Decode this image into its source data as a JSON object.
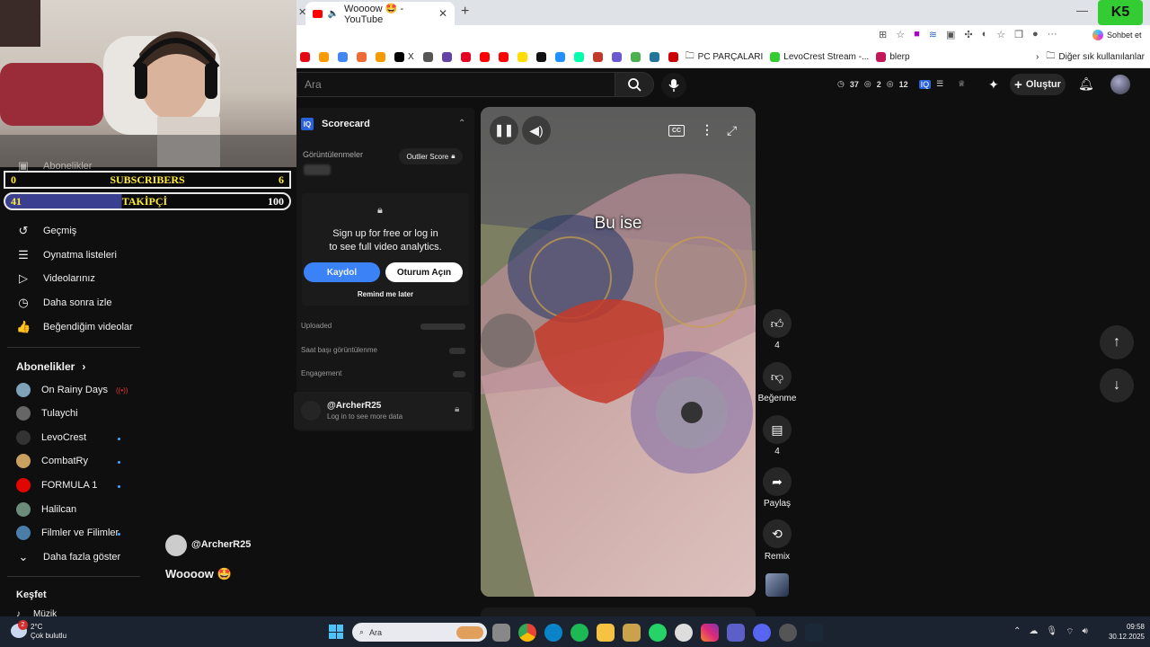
{
  "browser": {
    "tab_title": "Woooow 🤩 - YouTube",
    "bookmarks": [
      {
        "label": "",
        "color": "#e50914"
      },
      {
        "label": "",
        "color": "#ff9900"
      },
      {
        "label": "",
        "color": "#4285f4"
      },
      {
        "label": "",
        "color": "#f06a35"
      },
      {
        "label": "",
        "color": "#f59b00"
      },
      {
        "label": "X",
        "color": "#000000"
      },
      {
        "label": "",
        "color": "#555555"
      },
      {
        "label": "",
        "color": "#6441a5"
      },
      {
        "label": "",
        "color": "#e60023"
      },
      {
        "label": "",
        "color": "#ff0000"
      },
      {
        "label": "",
        "color": "#ff0000"
      },
      {
        "label": "",
        "color": "#ffdd00"
      },
      {
        "label": "",
        "color": "#111111"
      },
      {
        "label": "",
        "color": "#1e90ff"
      },
      {
        "label": "",
        "color": "#0fa"
      },
      {
        "label": "",
        "color": "#c0392b"
      },
      {
        "label": "",
        "color": "#6a5acd"
      },
      {
        "label": "",
        "color": "#4caf50"
      },
      {
        "label": "",
        "color": "#21759b"
      },
      {
        "label": "",
        "color": "#cc0000"
      }
    ],
    "bookmark_pc": "PC PARÇALARI",
    "bookmark_levo": "LevoCrest Stream -...",
    "bookmark_blerp": "blerp",
    "bookmark_other": "Diğer sık kullanılanlar",
    "chat_label": "Sohbet et"
  },
  "overlay": {
    "subs_left": "0",
    "subs_label": "SUBSCRIBERS",
    "subs_right": "6",
    "follow_left": "41",
    "follow_label": "TAKİPÇİ",
    "follow_right": "100"
  },
  "youtube": {
    "search_placeholder": "Ara",
    "stats": {
      "a": "37",
      "b": "2",
      "c": "12"
    },
    "create_label": "Oluştur"
  },
  "sidebar": {
    "cut_item": "Abonelikler",
    "items": [
      {
        "label": "Geçmiş",
        "icon": "history-icon",
        "glyph": "↺"
      },
      {
        "label": "Oynatma listeleri",
        "icon": "playlist-icon",
        "glyph": "☰"
      },
      {
        "label": "Videolarınız",
        "icon": "video-icon",
        "glyph": "▷"
      },
      {
        "label": "Daha sonra izle",
        "icon": "clock-icon",
        "glyph": "◷"
      },
      {
        "label": "Beğendiğim videolar",
        "icon": "like-icon",
        "glyph": "👍"
      }
    ],
    "subs_heading": "Abonelikler",
    "subs": [
      {
        "label": "On Rainy Days",
        "color": "#7fa2b8",
        "badge": "live"
      },
      {
        "label": "Tulaychi",
        "color": "#666666",
        "badge": ""
      },
      {
        "label": "LevoCrest",
        "color": "#333333",
        "badge": "dot"
      },
      {
        "label": "CombatRy",
        "color": "#c8a060",
        "badge": "dot"
      },
      {
        "label": "FORMULA 1",
        "color": "#e10600",
        "badge": "dot"
      },
      {
        "label": "Halilcan",
        "color": "#6c8c7a",
        "badge": ""
      },
      {
        "label": "Filmler ve Filimler",
        "color": "#4a7ea8",
        "badge": "dot"
      }
    ],
    "more_label": "Daha fazla göster",
    "explore_heading": "Keşfet",
    "music_label": "Müzik"
  },
  "scorecard": {
    "title": "Scorecard",
    "views_label": "Görüntülenmeler",
    "outlier_label": "Outlier Score",
    "signup_line1": "Sign up for free or log in",
    "signup_line2": "to see full video analytics.",
    "register_btn": "Kaydol",
    "login_btn": "Oturum Açın",
    "remind": "Remind me later",
    "uploaded": "Uploaded",
    "hourly_views": "Saat başı görüntülenme",
    "engagement": "Engagement",
    "channel": "@ArcherR25",
    "channel_sub": "Log in to see more data"
  },
  "video": {
    "caption": "Bu ise",
    "channel": "@ArcherR25",
    "title": "Woooow 🤩"
  },
  "actions": {
    "likes": "4",
    "dislike": "Beğenme",
    "comments": "4",
    "share": "Paylaş",
    "remix": "Remix"
  },
  "taskbar": {
    "temp": "2°C",
    "weather": "Çok bulutlu",
    "weather_badge": "2",
    "search": "Ara",
    "time": "09:58",
    "date": "30.12.2025"
  }
}
